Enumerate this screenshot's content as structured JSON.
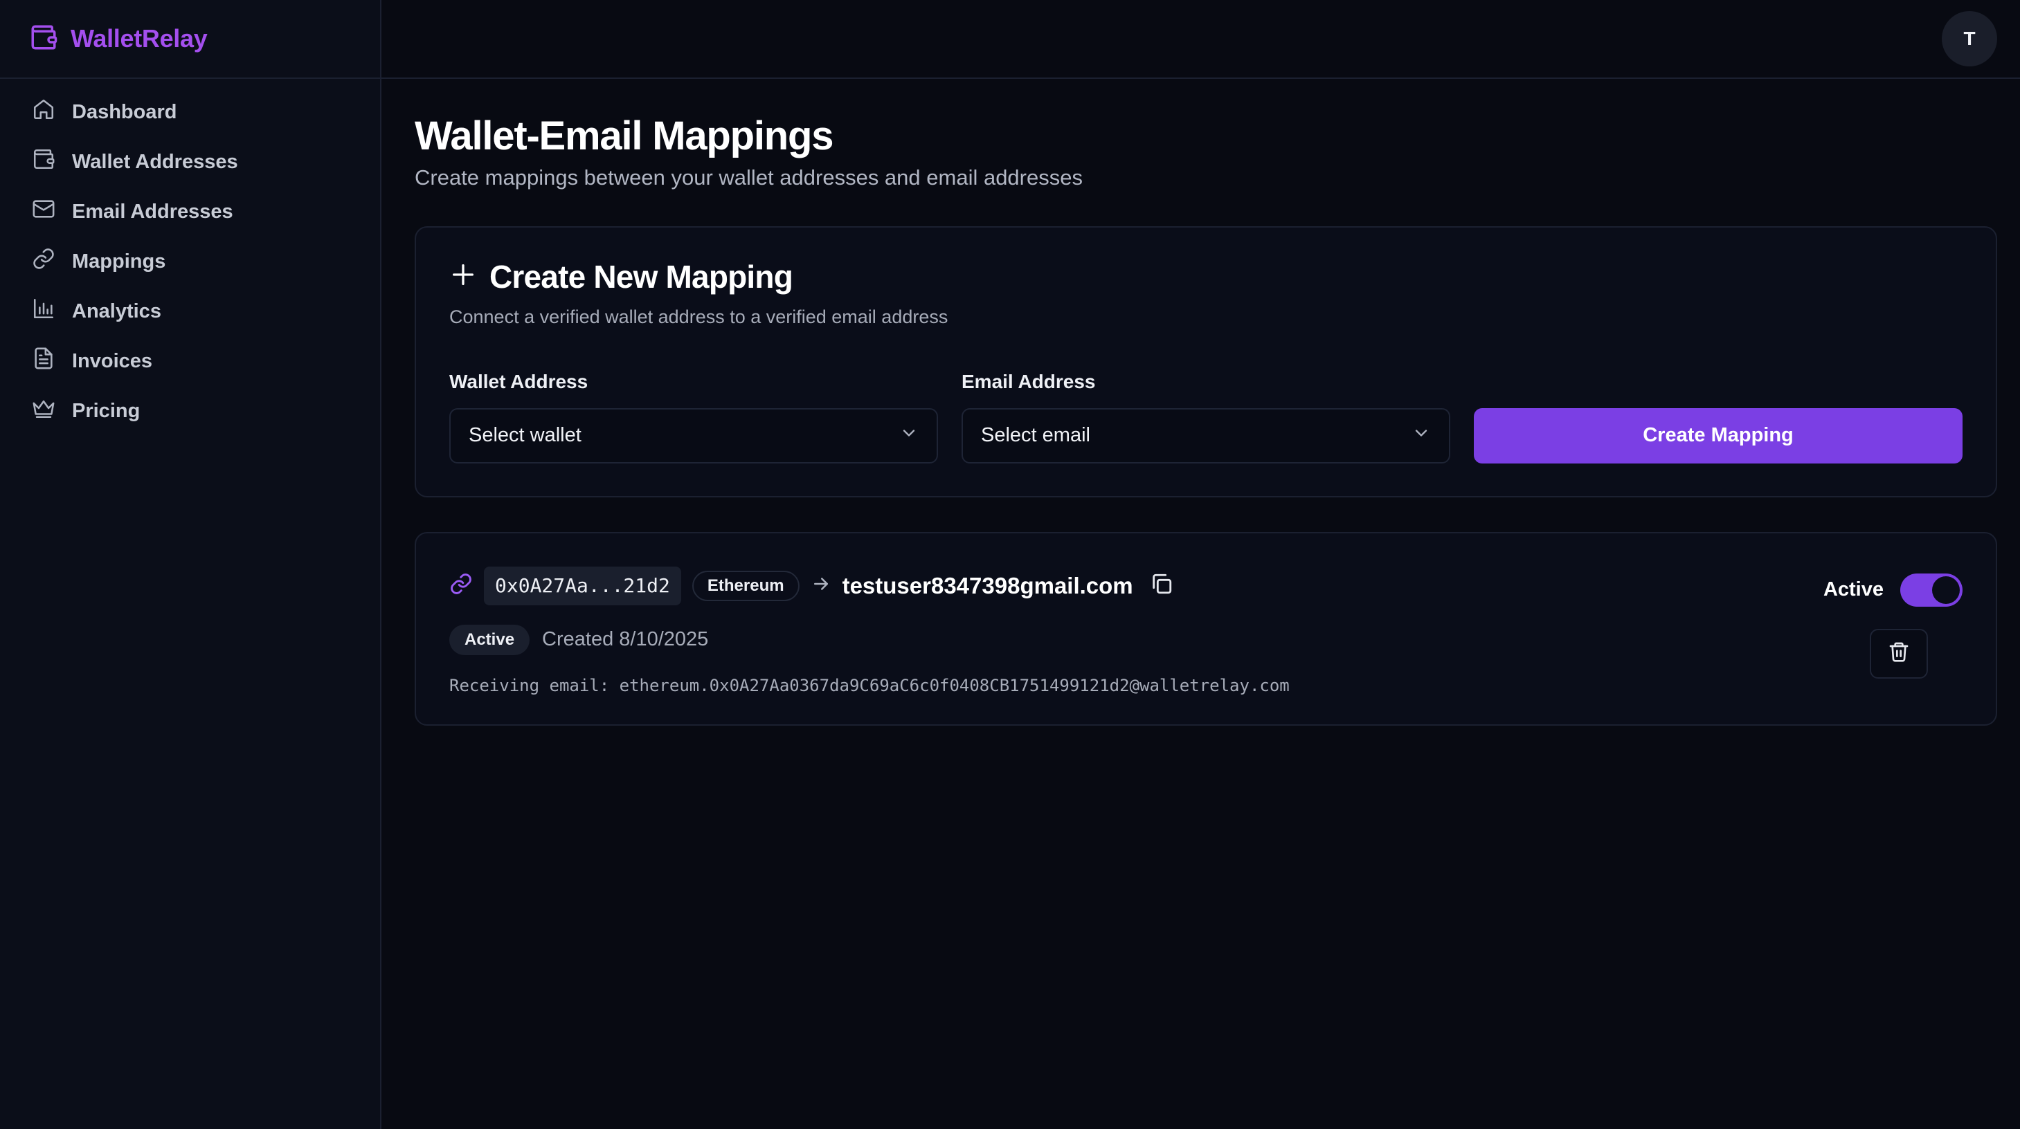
{
  "brand": {
    "name": "WalletRelay",
    "icon": "wallet-icon",
    "color": "#a44fee"
  },
  "sidebar": {
    "items": [
      {
        "label": "Dashboard",
        "icon": "home-icon"
      },
      {
        "label": "Wallet Addresses",
        "icon": "wallet-icon"
      },
      {
        "label": "Email Addresses",
        "icon": "mail-icon"
      },
      {
        "label": "Mappings",
        "icon": "link-icon"
      },
      {
        "label": "Analytics",
        "icon": "bar-chart-icon"
      },
      {
        "label": "Invoices",
        "icon": "file-text-icon"
      },
      {
        "label": "Pricing",
        "icon": "crown-icon"
      }
    ]
  },
  "header": {
    "avatar_initial": "T"
  },
  "page": {
    "title": "Wallet-Email Mappings",
    "subtitle": "Create mappings between your wallet addresses and email addresses"
  },
  "create": {
    "title": "Create New Mapping",
    "description": "Connect a verified wallet address to a verified email address",
    "wallet_label": "Wallet Address",
    "wallet_placeholder": "Select wallet",
    "email_label": "Email Address",
    "email_placeholder": "Select email",
    "button_label": "Create Mapping"
  },
  "mapping": {
    "address": "0x0A27Aa...21d2",
    "chain": "Ethereum",
    "email": "testuser8347398gmail.com",
    "status": "Active",
    "created": "Created 8/10/2025",
    "receiving": "Receiving email: ethereum.0x0A27Aa0367da9C69aC6c0f0408CB1751499121d2@walletrelay.com",
    "toggle_label": "Active",
    "toggle_on": true
  },
  "colors": {
    "accent": "#7b3fe4",
    "background": "#080a12",
    "sidebar": "#0b0e19",
    "border": "#1b2030"
  }
}
